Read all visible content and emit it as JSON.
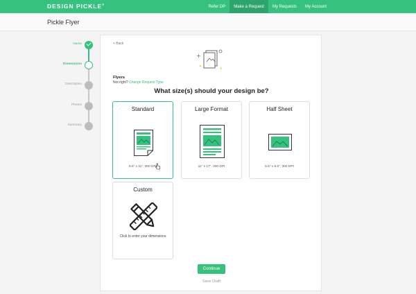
{
  "header": {
    "logo": "DESIGN PICKLE",
    "nav": [
      "Refer DP",
      "Make a Request",
      "My Requests",
      "My Account"
    ]
  },
  "page": {
    "title": "Pickle Flyer"
  },
  "steps": [
    {
      "label": "Name",
      "state": "done"
    },
    {
      "label": "Dimensions",
      "state": "current"
    },
    {
      "label": "Description",
      "state": "todo"
    },
    {
      "label": "Photos",
      "state": "todo"
    },
    {
      "label": "Summary",
      "state": "todo"
    }
  ],
  "form": {
    "back": "< Back",
    "type_title": "Flyers",
    "not_right": "Not right? ",
    "change_link": "Change Request Type",
    "question": "What size(s) should your design be?",
    "options": [
      {
        "name": "Standard",
        "spec": "8.5\" x 11\", 300 DPI",
        "icon": "flyer-portrait-icon"
      },
      {
        "name": "Large Format",
        "spec": "11\" x 17\", 300 DPI",
        "icon": "flyer-large-icon"
      },
      {
        "name": "Half Sheet",
        "spec": "5.5\" x 8.5\", 300 DPI",
        "icon": "flyer-landscape-icon"
      },
      {
        "name": "Custom",
        "spec": "Click to enter your dimensions",
        "icon": "ruler-pencil-icon"
      }
    ],
    "continue": "Continue",
    "save_draft": "Save Draft"
  },
  "colors": {
    "accent": "#35c27f",
    "accent_dark": "#2ba56b",
    "background": "#f4f4f4"
  }
}
